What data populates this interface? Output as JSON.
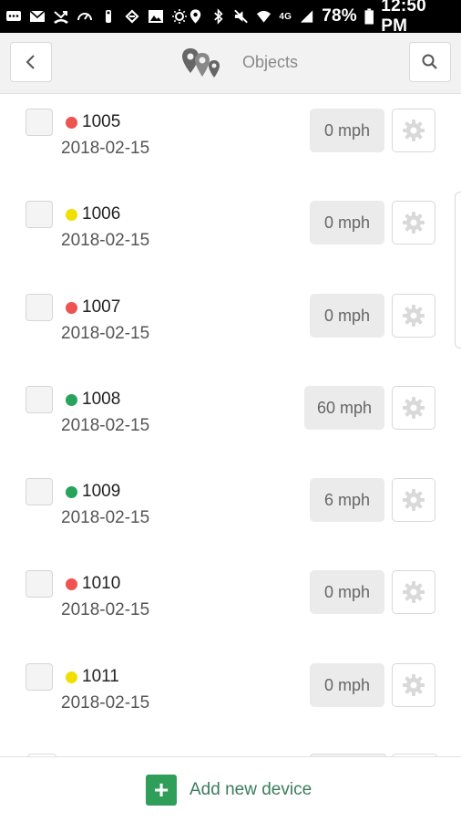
{
  "status_bar": {
    "battery": "78%",
    "time": "12:50 PM",
    "network": "4G",
    "left_icons": [
      "chat-icon",
      "mail-icon",
      "missed-call-icon",
      "speedometer-icon",
      "person-icon",
      "sync-icon",
      "image-icon",
      "brightness-icon"
    ],
    "right_icons": [
      "location-icon",
      "bluetooth-icon",
      "mute-icon",
      "wifi-icon",
      "signal-icon",
      "battery-icon"
    ]
  },
  "header": {
    "title": "Objects",
    "logo": "map-pins-logo",
    "back_icon": "chevron-left-icon",
    "search_icon": "search-icon"
  },
  "devices": [
    {
      "id": "1005",
      "date": "2018-02-15",
      "speed": "0 mph",
      "status": "red"
    },
    {
      "id": "1006",
      "date": "2018-02-15",
      "speed": "0 mph",
      "status": "yellow"
    },
    {
      "id": "1007",
      "date": "2018-02-15",
      "speed": "0 mph",
      "status": "red"
    },
    {
      "id": "1008",
      "date": "2018-02-15",
      "speed": "60 mph",
      "status": "green"
    },
    {
      "id": "1009",
      "date": "2018-02-15",
      "speed": "6 mph",
      "status": "green"
    },
    {
      "id": "1010",
      "date": "2018-02-15",
      "speed": "0 mph",
      "status": "red"
    },
    {
      "id": "1011",
      "date": "2018-02-15",
      "speed": "0 mph",
      "status": "yellow"
    }
  ],
  "status_colors": {
    "red": "#ef5350",
    "yellow": "#f0e000",
    "green": "#27a35a"
  },
  "footer": {
    "add_label": "Add new device",
    "add_icon": "plus-icon",
    "accent": "#2e9e58"
  }
}
